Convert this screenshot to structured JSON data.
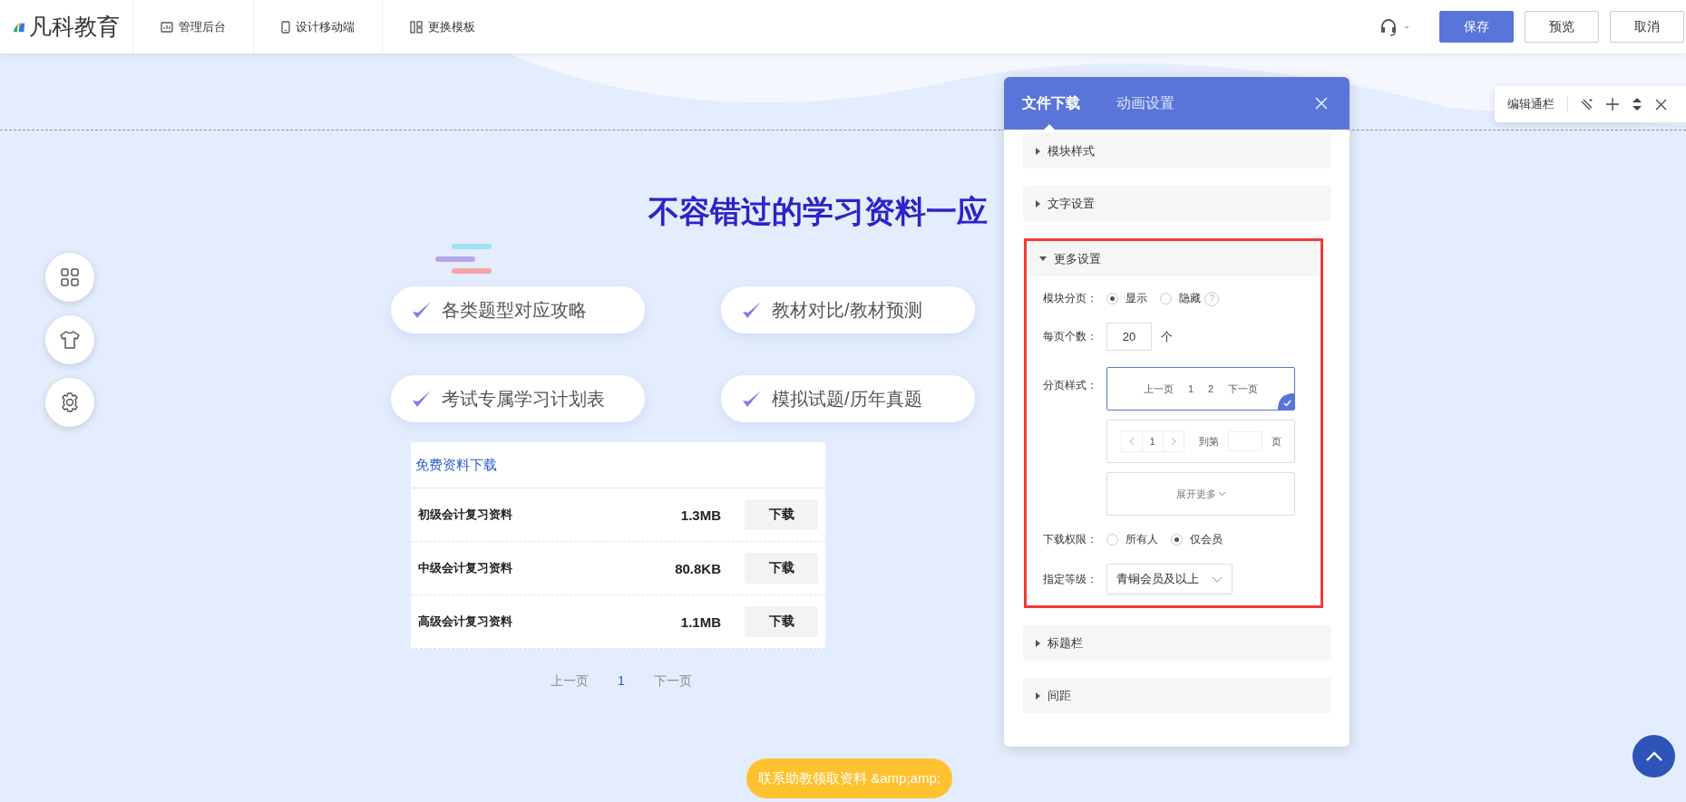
{
  "logo": {
    "text": "凡科教育"
  },
  "nav": [
    {
      "label": "管理后台",
      "kind": "chart"
    },
    {
      "label": "设计移动端",
      "kind": "phone"
    },
    {
      "label": "更换模板",
      "kind": "template"
    }
  ],
  "actions": [
    {
      "label": "保存",
      "kind": "primary"
    },
    {
      "label": "预览",
      "kind": "default"
    },
    {
      "label": "取消",
      "kind": "default"
    }
  ],
  "edit_toolbar": {
    "label": "编辑通栏"
  },
  "heading": "不容错过的学习资料一应",
  "features": [
    "各类题型对应攻略",
    "教材对比/教材预测",
    "考试专属学习计划表",
    "模拟试题/历年真题"
  ],
  "download_table": {
    "title": "免费资料下载",
    "rows": [
      {
        "name": "初级会计复习资料",
        "size": "1.3MB",
        "action": "下载"
      },
      {
        "name": "中级会计复习资料",
        "size": "80.8KB",
        "action": "下载"
      },
      {
        "name": "高级会计复习资料",
        "size": "1.1MB",
        "action": "下载"
      }
    ]
  },
  "pagination": {
    "prev": "上一页",
    "pages": [
      {
        "label": "1",
        "selected": true
      }
    ],
    "next": "下一页"
  },
  "contact_button": "联系助教领取资料 &amp;amp;",
  "panel": {
    "tabs": [
      {
        "label": "文件下载",
        "selected": true
      },
      {
        "label": "动画设置",
        "selected": false
      }
    ],
    "sections": [
      {
        "title": "模块样式",
        "expanded": false,
        "highlighted": false
      },
      {
        "title": "文字设置",
        "expanded": false,
        "highlighted": false
      },
      {
        "title": "更多设置",
        "expanded": true,
        "highlighted": true,
        "content": {
          "paging": {
            "label": "模块分页：",
            "options": [
              {
                "label": "显示",
                "selected": true
              },
              {
                "label": "隐藏",
                "selected": false
              }
            ],
            "help": "?"
          },
          "per_page": {
            "label": "每页个数：",
            "value": "20",
            "unit": "个"
          },
          "page_style": {
            "label": "分页样式：",
            "styles": [
              {
                "kind": "simple",
                "selected": true,
                "items": [
                  "上一页",
                  "1",
                  "2",
                  "下一页"
                ]
              },
              {
                "kind": "jump",
                "selected": false,
                "page": "1",
                "jump_label": "到第",
                "unit": "页"
              }
            ],
            "more": "展开更多"
          },
          "permission": {
            "label": "下载权限：",
            "options": [
              {
                "label": "所有人",
                "selected": false
              },
              {
                "label": "仅会员",
                "selected": true
              }
            ]
          },
          "level": {
            "label": "指定等级：",
            "value": "青铜会员及以上"
          }
        }
      },
      {
        "title": "标题栏",
        "expanded": false,
        "highlighted": false
      },
      {
        "title": "间距",
        "expanded": false,
        "highlighted": false
      }
    ]
  }
}
